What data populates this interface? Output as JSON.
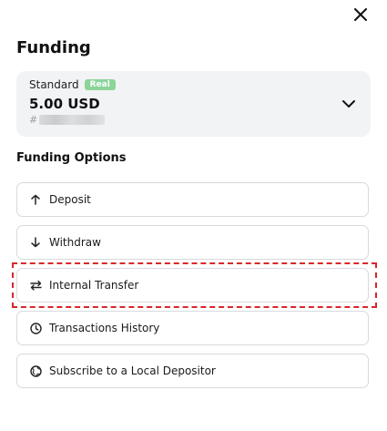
{
  "dialog": {
    "title": "Funding"
  },
  "account": {
    "type": "Standard",
    "badge": "Real",
    "balance": "5.00 USD",
    "id_prefix": "#"
  },
  "options": {
    "section_title": "Funding Options",
    "items": [
      {
        "label": "Deposit",
        "icon": "arrow-up-icon"
      },
      {
        "label": "Withdraw",
        "icon": "arrow-down-icon"
      },
      {
        "label": "Internal Transfer",
        "icon": "transfer-arrows-icon"
      },
      {
        "label": "Transactions History",
        "icon": "clock-icon"
      },
      {
        "label": "Subscribe to a Local Depositor",
        "icon": "globe-icon"
      }
    ]
  },
  "colors": {
    "badge": "#8bd49a",
    "card_bg": "#f2f3f5",
    "highlight": "#d9262b"
  }
}
